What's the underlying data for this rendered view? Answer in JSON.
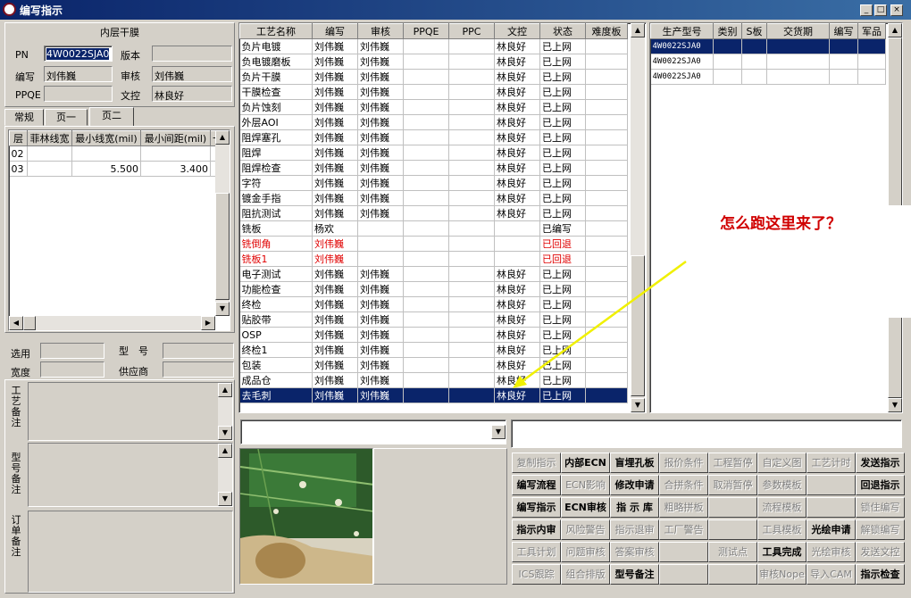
{
  "window": {
    "title": "编写指示",
    "min": "_",
    "max": "□",
    "close": "×"
  },
  "left": {
    "group_title": "内层干膜",
    "pn_label": "PN",
    "pn_value": "4W0022SJA0",
    "ver_label": "版本",
    "ver_value": "",
    "bx_label": "编写",
    "bx_value": "刘伟巍",
    "sh_label": "审核",
    "sh_value": "刘伟巍",
    "ppqe_label": "PPQE",
    "ppqe_value": "",
    "wk_label": "文控",
    "wk_value": "林良好",
    "tabs": [
      "常规",
      "页一",
      "页二"
    ],
    "layer_headers": [
      "层",
      "菲林线宽",
      "最小线宽(mil)",
      "最小间距(mil)",
      "卡"
    ],
    "layer_rows": [
      [
        "02",
        "",
        "",
        ""
      ],
      [
        "03",
        "",
        "5.500",
        "3.400"
      ]
    ],
    "xy_label": "选用",
    "xh_label": "型　号",
    "kd_label": "宽度",
    "gys_label": "供应商",
    "note1": "工艺备注",
    "note2": "型号备注",
    "note3": "订单备注"
  },
  "process_table": {
    "headers": [
      "工艺名称",
      "编写",
      "审核",
      "PPQE",
      "PPC",
      "文控",
      "状态",
      "难度板"
    ],
    "rows": [
      {
        "c": [
          "负片电镀",
          "刘伟巍",
          "刘伟巍",
          "",
          "",
          "林良好",
          "已上网",
          ""
        ],
        "style": ""
      },
      {
        "c": [
          "负电镀磨板",
          "刘伟巍",
          "刘伟巍",
          "",
          "",
          "林良好",
          "已上网",
          ""
        ],
        "style": ""
      },
      {
        "c": [
          "负片干膜",
          "刘伟巍",
          "刘伟巍",
          "",
          "",
          "林良好",
          "已上网",
          ""
        ],
        "style": ""
      },
      {
        "c": [
          "干膜检查",
          "刘伟巍",
          "刘伟巍",
          "",
          "",
          "林良好",
          "已上网",
          ""
        ],
        "style": ""
      },
      {
        "c": [
          "负片蚀刻",
          "刘伟巍",
          "刘伟巍",
          "",
          "",
          "林良好",
          "已上网",
          ""
        ],
        "style": ""
      },
      {
        "c": [
          "外层AOI",
          "刘伟巍",
          "刘伟巍",
          "",
          "",
          "林良好",
          "已上网",
          ""
        ],
        "style": ""
      },
      {
        "c": [
          "阻焊塞孔",
          "刘伟巍",
          "刘伟巍",
          "",
          "",
          "林良好",
          "已上网",
          ""
        ],
        "style": ""
      },
      {
        "c": [
          "阻焊",
          "刘伟巍",
          "刘伟巍",
          "",
          "",
          "林良好",
          "已上网",
          ""
        ],
        "style": ""
      },
      {
        "c": [
          "阻焊检查",
          "刘伟巍",
          "刘伟巍",
          "",
          "",
          "林良好",
          "已上网",
          ""
        ],
        "style": ""
      },
      {
        "c": [
          "字符",
          "刘伟巍",
          "刘伟巍",
          "",
          "",
          "林良好",
          "已上网",
          ""
        ],
        "style": ""
      },
      {
        "c": [
          "镀金手指",
          "刘伟巍",
          "刘伟巍",
          "",
          "",
          "林良好",
          "已上网",
          ""
        ],
        "style": ""
      },
      {
        "c": [
          "阻抗测试",
          "刘伟巍",
          "刘伟巍",
          "",
          "",
          "林良好",
          "已上网",
          ""
        ],
        "style": ""
      },
      {
        "c": [
          "铣板",
          "杨欢",
          "",
          "",
          "",
          "",
          "已编写",
          ""
        ],
        "style": ""
      },
      {
        "c": [
          "铣倒角",
          "刘伟巍",
          "",
          "",
          "",
          "",
          "已回退",
          ""
        ],
        "style": "red"
      },
      {
        "c": [
          "铣板1",
          "刘伟巍",
          "",
          "",
          "",
          "",
          "已回退",
          ""
        ],
        "style": "red"
      },
      {
        "c": [
          "电子测试",
          "刘伟巍",
          "刘伟巍",
          "",
          "",
          "林良好",
          "已上网",
          ""
        ],
        "style": ""
      },
      {
        "c": [
          "功能检查",
          "刘伟巍",
          "刘伟巍",
          "",
          "",
          "林良好",
          "已上网",
          ""
        ],
        "style": ""
      },
      {
        "c": [
          "终检",
          "刘伟巍",
          "刘伟巍",
          "",
          "",
          "林良好",
          "已上网",
          ""
        ],
        "style": ""
      },
      {
        "c": [
          "贴胶带",
          "刘伟巍",
          "刘伟巍",
          "",
          "",
          "林良好",
          "已上网",
          ""
        ],
        "style": ""
      },
      {
        "c": [
          "OSP",
          "刘伟巍",
          "刘伟巍",
          "",
          "",
          "林良好",
          "已上网",
          ""
        ],
        "style": ""
      },
      {
        "c": [
          "终检1",
          "刘伟巍",
          "刘伟巍",
          "",
          "",
          "林良好",
          "已上网",
          ""
        ],
        "style": ""
      },
      {
        "c": [
          "包装",
          "刘伟巍",
          "刘伟巍",
          "",
          "",
          "林良好",
          "已上网",
          ""
        ],
        "style": ""
      },
      {
        "c": [
          "成品仓",
          "刘伟巍",
          "刘伟巍",
          "",
          "",
          "林良好",
          "已上网",
          ""
        ],
        "style": ""
      },
      {
        "c": [
          "去毛刺",
          "刘伟巍",
          "刘伟巍",
          "",
          "",
          "林良好",
          "已上网",
          ""
        ],
        "style": "sel"
      }
    ]
  },
  "model_table": {
    "headers": [
      "生产型号",
      "类别",
      "S板",
      "交货期",
      "编写",
      "军品"
    ],
    "rows": [
      [
        "4W0022SJA0",
        "",
        "",
        "",
        "",
        ""
      ],
      [
        "4W0022SJA0",
        "",
        "",
        "",
        "",
        ""
      ],
      [
        "4W0022SJA0",
        "",
        "",
        "",
        "",
        ""
      ]
    ]
  },
  "annotation": {
    "text": "怎么跑这里来了？",
    "color": "#d00000",
    "arrow_color": "#f0f000"
  },
  "buttons": [
    [
      {
        "t": "复制指示",
        "d": true
      },
      {
        "t": "内部ECN",
        "d": false
      },
      {
        "t": "盲埋孔板",
        "d": false
      },
      {
        "t": "报价条件",
        "d": true
      },
      {
        "t": "工程暂停",
        "d": true
      },
      {
        "t": "自定义图",
        "d": true
      },
      {
        "t": "工艺计时",
        "d": true
      },
      {
        "t": "发送指示",
        "d": false
      }
    ],
    [
      {
        "t": "编写流程",
        "d": false
      },
      {
        "t": "ECN影响",
        "d": true
      },
      {
        "t": "修改申请",
        "d": false
      },
      {
        "t": "合拼条件",
        "d": true
      },
      {
        "t": "取消暂停",
        "d": true
      },
      {
        "t": "参数模板",
        "d": true
      },
      {
        "t": "",
        "d": true
      },
      {
        "t": "回退指示",
        "d": false
      }
    ],
    [
      {
        "t": "编写指示",
        "d": false
      },
      {
        "t": "ECN审核",
        "d": false
      },
      {
        "t": "指 示 库",
        "d": false
      },
      {
        "t": "粗略拼板",
        "d": true
      },
      {
        "t": "",
        "d": true
      },
      {
        "t": "流程模板",
        "d": true
      },
      {
        "t": "",
        "d": true
      },
      {
        "t": "锁住编写",
        "d": true
      }
    ],
    [
      {
        "t": "指示内审",
        "d": false
      },
      {
        "t": "风险警告",
        "d": true
      },
      {
        "t": "指示退审",
        "d": true
      },
      {
        "t": "工厂警告",
        "d": true
      },
      {
        "t": "",
        "d": true
      },
      {
        "t": "工具模板",
        "d": true
      },
      {
        "t": "光绘申请",
        "d": false
      },
      {
        "t": "解锁编写",
        "d": true
      }
    ],
    [
      {
        "t": "工具计划",
        "d": true
      },
      {
        "t": "问题审核",
        "d": true
      },
      {
        "t": "答案审核",
        "d": true
      },
      {
        "t": "",
        "d": true
      },
      {
        "t": "测试点",
        "d": true
      },
      {
        "t": "工具完成",
        "d": false
      },
      {
        "t": "光绘审核",
        "d": true
      },
      {
        "t": "发送文控",
        "d": true
      }
    ],
    [
      {
        "t": "ICS跟踪",
        "d": true
      },
      {
        "t": "组合排版",
        "d": true
      },
      {
        "t": "型号备注",
        "d": false
      },
      {
        "t": "",
        "d": true
      },
      {
        "t": "",
        "d": true
      },
      {
        "t": "审核Nope",
        "d": true
      },
      {
        "t": "导入CAM",
        "d": true
      },
      {
        "t": "指示检查",
        "d": false
      }
    ]
  ]
}
